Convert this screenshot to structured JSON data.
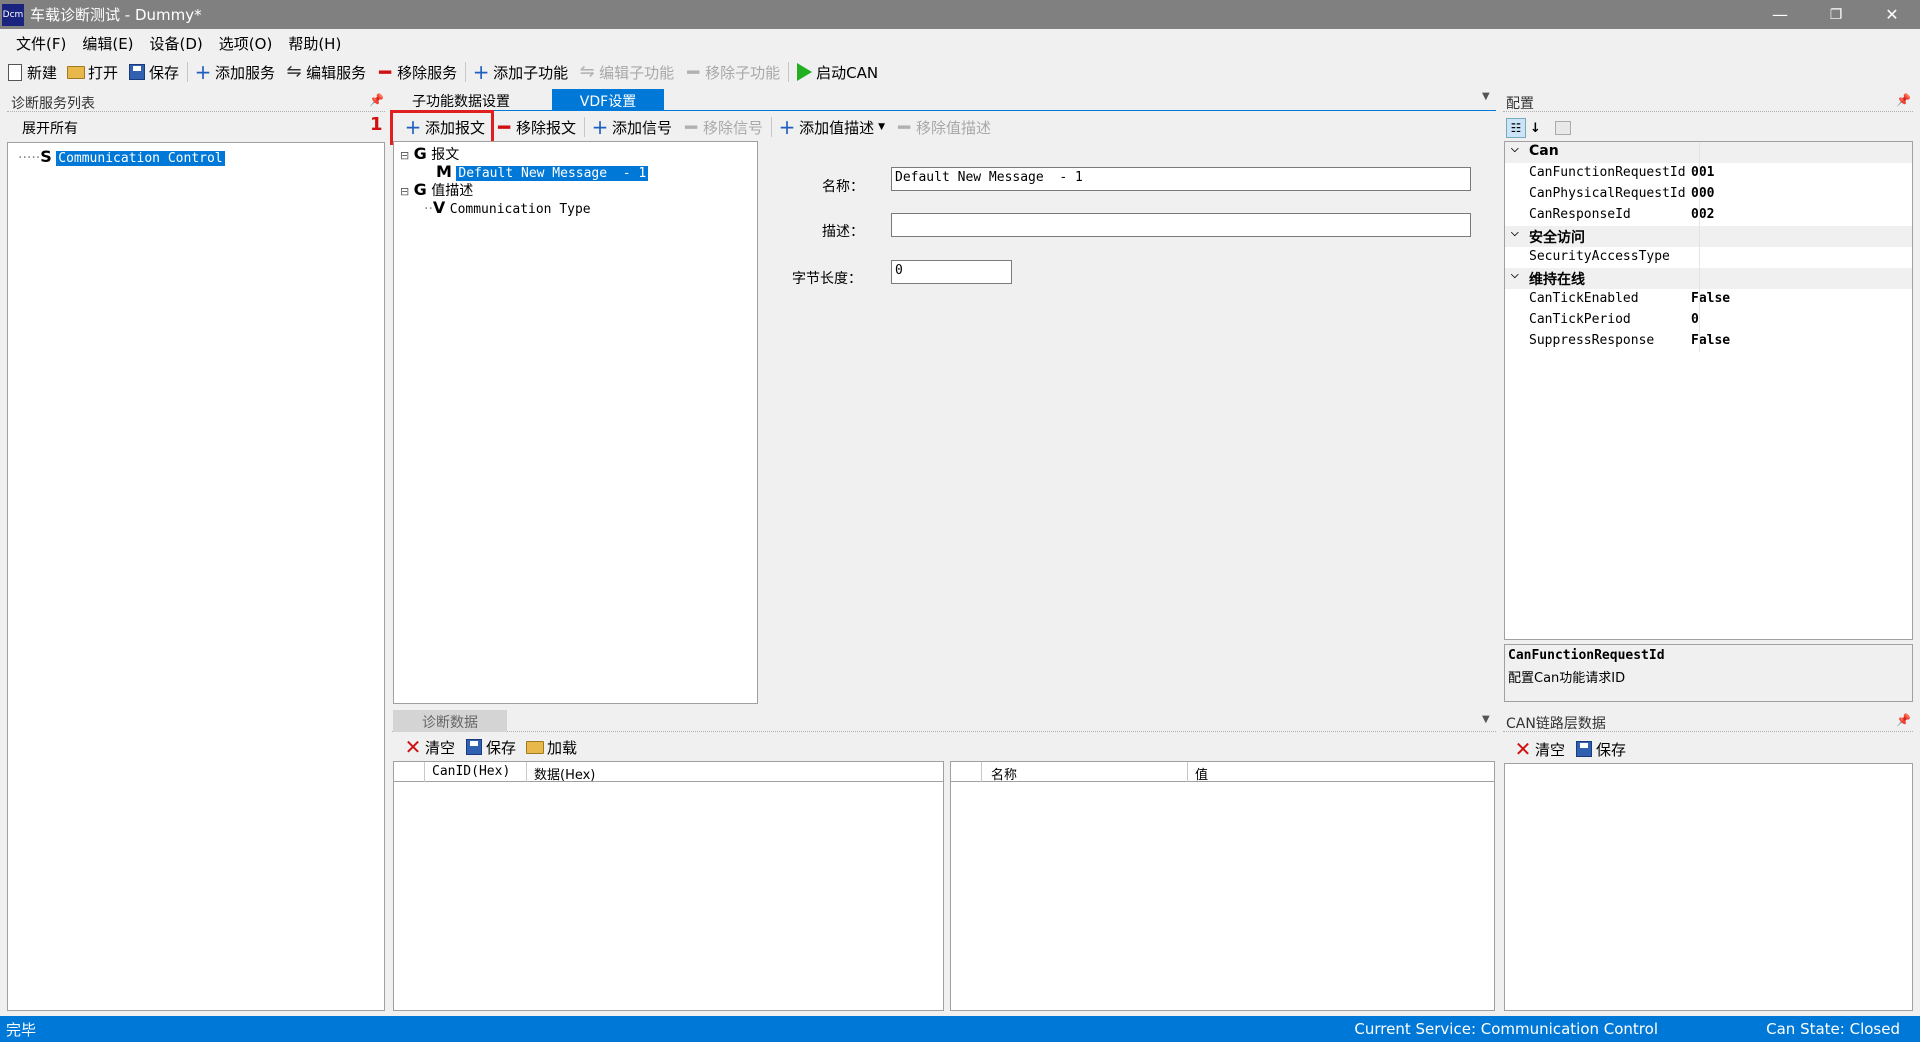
{
  "window": {
    "app_icon": "Dcm",
    "title": "车载诊断测试 - Dummy*",
    "minimize": "—",
    "restore": "❐",
    "close": "✕"
  },
  "menu": [
    {
      "label": "文件(F)"
    },
    {
      "label": "编辑(E)"
    },
    {
      "label": "设备(D)"
    },
    {
      "label": "选项(O)"
    },
    {
      "label": "帮助(H)"
    }
  ],
  "toolbar": {
    "new": "新建",
    "open": "打开",
    "save": "保存",
    "add_service": "添加服务",
    "edit_service": "编辑服务",
    "remove_service": "移除服务",
    "add_sub": "添加子功能",
    "edit_sub": "编辑子功能",
    "remove_sub": "移除子功能",
    "start_can": "启动CAN"
  },
  "left_panel": {
    "title": "诊断服务列表",
    "expand_all": "展开所有",
    "tree": [
      {
        "letter": "S",
        "label": "Communication Control"
      }
    ]
  },
  "center": {
    "tabs": [
      {
        "label": "子功能数据设置"
      },
      {
        "label": "VDF设置"
      }
    ],
    "toolbar": {
      "add_msg": "添加报文",
      "remove_msg": "移除报文",
      "add_signal": "添加信号",
      "remove_signal": "移除信号",
      "add_value_desc": "添加值描述",
      "remove_value_desc": "移除值描述"
    },
    "annotation": "1",
    "tree": [
      {
        "letter": "G",
        "label": "报文"
      },
      {
        "letter": "M",
        "label": "Default New Message  - 1"
      },
      {
        "letter": "G",
        "label": "值描述"
      },
      {
        "letter": "V",
        "label": "Communication Type"
      }
    ],
    "form": {
      "name_label": "名称：",
      "name_value": "Default New Message  - 1",
      "desc_label": "描述：",
      "desc_value": "",
      "len_label": "字节长度：",
      "len_value": "0"
    }
  },
  "config": {
    "title": "配置",
    "categories": [
      {
        "name": "Can",
        "props": [
          {
            "name": "CanFunctionRequestId",
            "value": "001"
          },
          {
            "name": "CanPhysicalRequestId",
            "value": "000"
          },
          {
            "name": "CanResponseId",
            "value": "002"
          }
        ]
      },
      {
        "name": "安全访问",
        "props": [
          {
            "name": "SecurityAccessType",
            "value": ""
          }
        ]
      },
      {
        "name": "维持在线",
        "props": [
          {
            "name": "CanTickEnabled",
            "value": "False"
          },
          {
            "name": "CanTickPeriod",
            "value": "0"
          },
          {
            "name": "SuppressResponse",
            "value": "False"
          }
        ]
      }
    ],
    "desc_title": "CanFunctionRequestId",
    "desc_text": "配置Can功能请求ID"
  },
  "diag": {
    "tab": "诊断数据",
    "clear": "清空",
    "save": "保存",
    "load": "加载",
    "left_cols": [
      "CanID(Hex)",
      "数据(Hex)"
    ],
    "right_cols": [
      "名称",
      "值"
    ]
  },
  "can_panel": {
    "title": "CAN链路层数据",
    "clear": "清空",
    "save": "保存"
  },
  "status": {
    "left": "完毕",
    "service": "Current Service: Communication Control",
    "can_state": "Can State: Closed"
  },
  "colors": {
    "accent": "#0078d7",
    "highlight_box": "#e02020"
  }
}
